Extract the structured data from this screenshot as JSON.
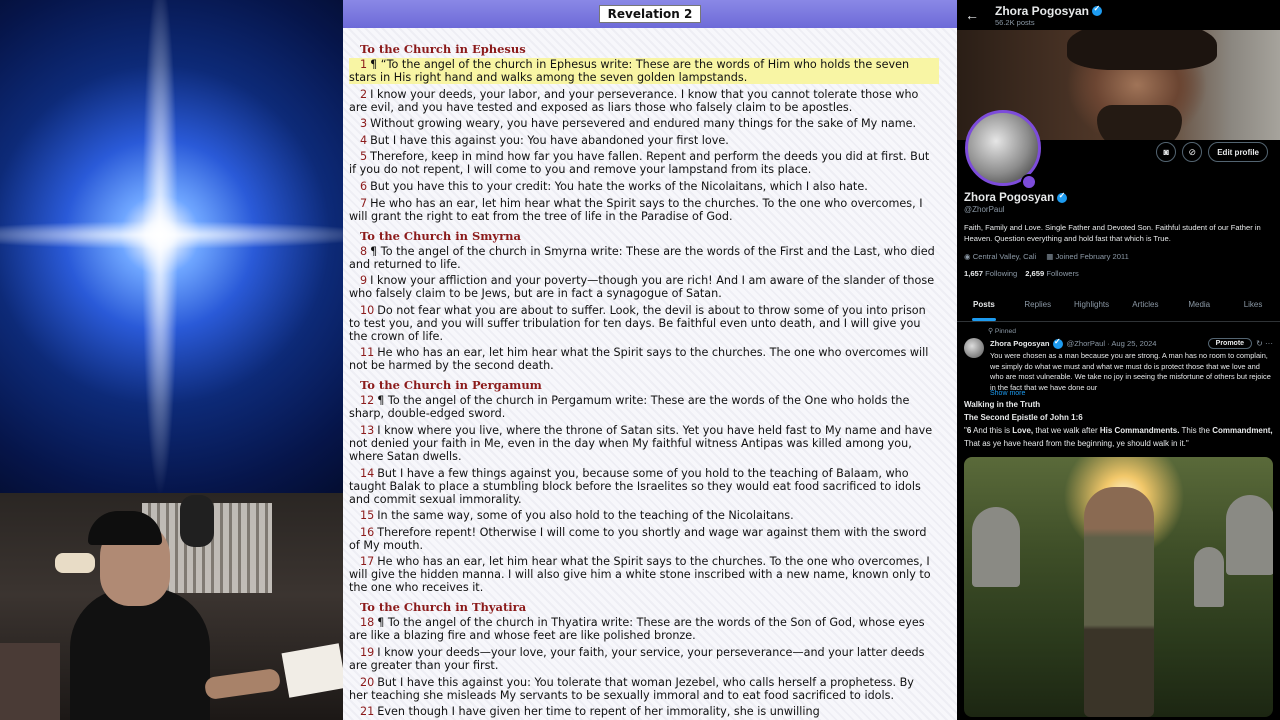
{
  "bible": {
    "chapter_title": "Revelation 2",
    "sections": [
      {
        "heading": "To the Church in Ephesus",
        "verses": [
          {
            "num": "1",
            "text": "¶ “To the angel of the church in Ephesus write: These are the words of Him who holds the seven stars in His right hand and walks among the seven golden lampstands.",
            "highlight": true
          },
          {
            "num": "2",
            "text": "I know your deeds, your labor, and your perseverance. I know that you cannot tolerate those who are evil, and you have tested and exposed as liars those who falsely claim to be apostles."
          },
          {
            "num": "3",
            "text": "Without growing weary, you have persevered and endured many things for the sake of My name."
          },
          {
            "num": "4",
            "text": "But I have this against you: You have abandoned your first love."
          },
          {
            "num": "5",
            "text": "Therefore, keep in mind how far you have fallen. Repent and perform the deeds you did at first. But if you do not repent, I will come to you and remove your lampstand from its place."
          },
          {
            "num": "6",
            "text": "But you have this to your credit: You hate the works of the Nicolaitans, which I also hate."
          },
          {
            "num": "7",
            "text": "He who has an ear, let him hear what the Spirit says to the churches. To the one who overcomes, I will grant the right to eat from the tree of life in the Paradise of God."
          }
        ]
      },
      {
        "heading": "To the Church in Smyrna",
        "verses": [
          {
            "num": "8",
            "text": "¶ To the angel of the church in Smyrna write: These are the words of the First and the Last, who died and returned to life."
          },
          {
            "num": "9",
            "text": "I know your affliction and your poverty—though you are rich! And I am aware of the slander of those who falsely claim to be Jews, but are in fact a synagogue of Satan."
          },
          {
            "num": "10",
            "text": "Do not fear what you are about to suffer. Look, the devil is about to throw some of you into prison to test you, and you will suffer tribulation for ten days. Be faithful even unto death, and I will give you the crown of life."
          },
          {
            "num": "11",
            "text": "He who has an ear, let him hear what the Spirit says to the churches. The one who overcomes will not be harmed by the second death."
          }
        ]
      },
      {
        "heading": "To the Church in Pergamum",
        "verses": [
          {
            "num": "12",
            "text": "¶ To the angel of the church in Pergamum write: These are the words of the One who holds the sharp, double-edged sword."
          },
          {
            "num": "13",
            "text": "I know where you live, where the throne of Satan sits. Yet you have held fast to My name and have not denied your faith in Me, even in the day when My faithful witness Antipas was killed among you, where Satan dwells."
          },
          {
            "num": "14",
            "text": "But I have a few things against you, because some of you hold to the teaching of Balaam, who taught Balak to place a stumbling block before the Israelites so they would eat food sacrificed to idols and commit sexual immorality."
          },
          {
            "num": "15",
            "text": "In the same way, some of you also hold to the teaching of the Nicolaitans."
          },
          {
            "num": "16",
            "text": "Therefore repent! Otherwise I will come to you shortly and wage war against them with the sword of My mouth."
          },
          {
            "num": "17",
            "text": "He who has an ear, let him hear what the Spirit says to the churches. To the one who overcomes, I will give the hidden manna. I will also give him a white stone inscribed with a new name, known only to the one who receives it."
          }
        ]
      },
      {
        "heading": "To the Church in Thyatira",
        "verses": [
          {
            "num": "18",
            "text": "¶ To the angel of the church in Thyatira write: These are the words of the Son of God, whose eyes are like a blazing fire and whose feet are like polished bronze."
          },
          {
            "num": "19",
            "text": "I know your deeds—your love, your faith, your service, your perseverance—and your latter deeds are greater than your first."
          },
          {
            "num": "20",
            "text": "But I have this against you: You tolerate that woman Jezebel, who calls herself a prophetess. By her teaching she misleads My servants to be sexually immoral and to eat food sacrificed to idols."
          },
          {
            "num": "21",
            "text": "Even though I have given her time to repent of her immorality, she is unwilling"
          }
        ]
      }
    ]
  },
  "profile": {
    "topbar_name": "Zhora Pogosyan",
    "posts_count": "56.2K posts",
    "edit_profile_label": "Edit profile",
    "display_name": "Zhora Pogosyan",
    "handle": "@ZhorPaul",
    "bio": "Faith, Family and Love. Single Father and Devoted Son. Faithful student of our Father in Heaven. Question everything and hold fast that which is True.",
    "location": "Central Valley, Cali",
    "joined": "Joined February 2011",
    "following_count": "1,657",
    "following_label": "Following",
    "followers_count": "2,659",
    "followers_label": "Followers",
    "tabs": [
      "Posts",
      "Replies",
      "Highlights",
      "Articles",
      "Media",
      "Likes"
    ],
    "active_tab": "Posts",
    "accent_color": "#1d9bf0",
    "avatar_ring_color": "#7d4cdb"
  },
  "pinned_post": {
    "pinned_label": "Pinned",
    "author": "Zhora Pogosyan",
    "handle_date": "@ZhorPaul · Aug 25, 2024",
    "promote_label": "Promote",
    "text": "You were chosen as a man because you are strong. A man has no room to complain, we simply do what we must and what we must do is protect those that we love and who are most vulnerable. We take no joy in seeing the misfortune of others but rejoice in the fact that we have done our",
    "show_more": "Show more"
  },
  "scripture_card": {
    "title": "Walking in the Truth",
    "reference": "The Second Epistle of John 1:6",
    "verse_num": "6",
    "part1": "And this is",
    "love": "Love,",
    "part2": "that we walk after",
    "commandments": "His Commandments.",
    "part3": "This the",
    "commandment": "Commandment,",
    "part4": "That as ye have heard from the beginning, ye should walk in it.\""
  }
}
